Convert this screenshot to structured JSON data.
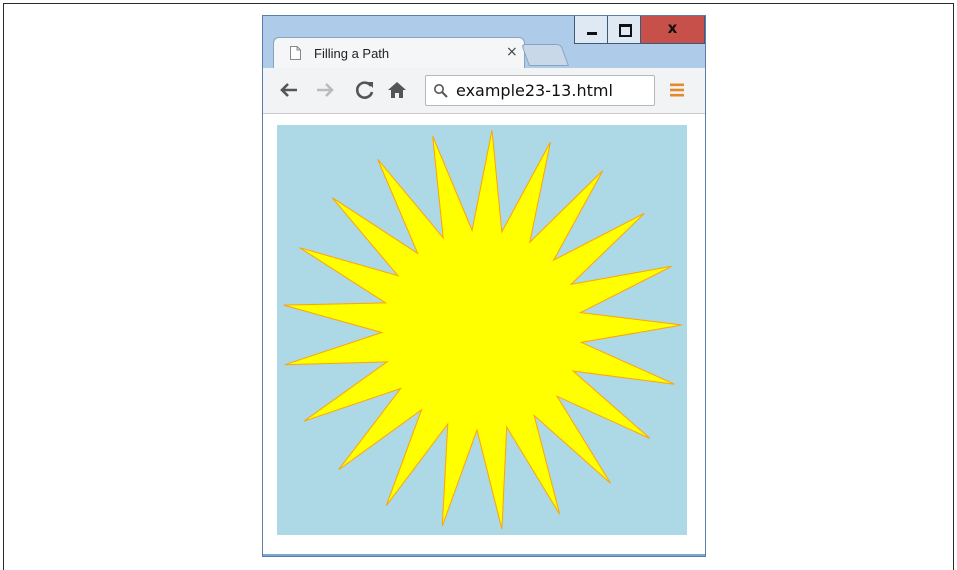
{
  "window": {
    "tab_title": "Filling a Path",
    "tab_close": "×",
    "close_glyph": "x"
  },
  "toolbar": {
    "url": "example23-13.html"
  },
  "icons": [
    "page-icon",
    "back-arrow-icon",
    "forward-arrow-icon",
    "reload-icon",
    "home-icon",
    "search-icon",
    "menu-icon",
    "minimize-icon",
    "maximize-icon",
    "close-icon"
  ],
  "canvas": {
    "background_color": "#add8e6",
    "fill_color": "#ffff00",
    "stroke_color": "#ffa500",
    "star_points": 21
  }
}
